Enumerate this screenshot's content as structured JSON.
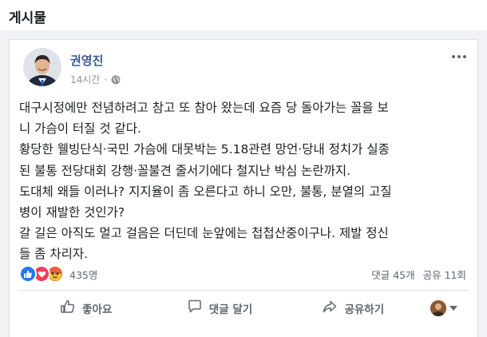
{
  "section": {
    "title": "게시물"
  },
  "post": {
    "author": "권영진",
    "time": "14시간",
    "separator": "·",
    "privacy_icon": "globe-icon",
    "lines": [
      "대구시정에만 전념하려고 참고 또 참아 왔는데 요즘 당 돌아가는 꼴을 보",
      "니 가슴이 터질 것 같다.",
      "황당한 웰빙단식·국민 가슴에 대못박는 5.18관련 망언·당내 정치가 실종",
      "된 불통 전당대회 강행·꼴불견 줄서기에다 철지난 박심 논란까지.",
      "도대체 왜들 이러나? 지지율이 좀 오른다고 하니 오만, 불통, 분열의 고질",
      "병이 재발한 것인가?",
      "갈 길은 아직도 멀고 걸음은 더딘데 눈앞에는 첩첩산중이구나. 제발 정신",
      "들 좀 차리자."
    ]
  },
  "reactions": {
    "icons": [
      "like-reaction-icon",
      "love-reaction-icon",
      "angry-reaction-icon"
    ],
    "count": "435명",
    "comments": "댓글 45개",
    "shares": "공유 11회"
  },
  "actions": {
    "like": "좋아요",
    "comment": "댓글 달기",
    "share": "공유하기"
  },
  "colors": {
    "author": "#385898",
    "like": "#2078f4",
    "love": "#f33e58",
    "angry": "#f0a330"
  }
}
